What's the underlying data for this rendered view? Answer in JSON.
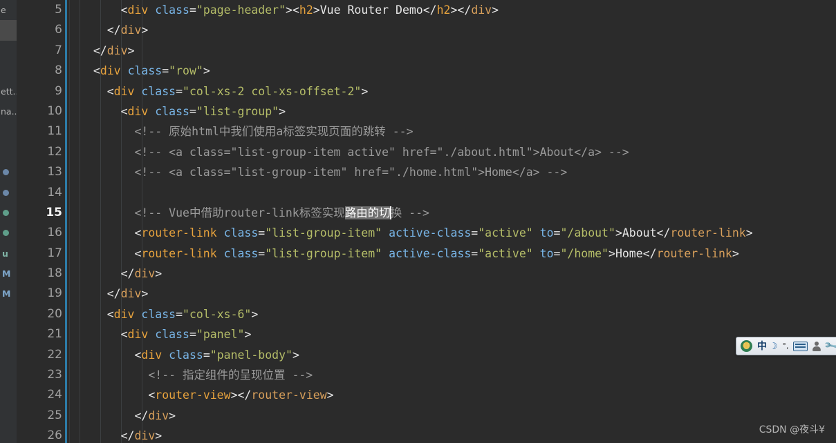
{
  "editor": {
    "first_line_number": 5,
    "active_line_number": 15,
    "lines": [
      {
        "n": 5,
        "segments": [
          {
            "t": "pun",
            "v": "      <"
          },
          {
            "t": "tag",
            "v": "div"
          },
          {
            "t": "pun",
            "v": " "
          },
          {
            "t": "attr",
            "v": "class"
          },
          {
            "t": "pun",
            "v": "="
          },
          {
            "t": "str",
            "v": "\"page-header\""
          },
          {
            "t": "pun",
            "v": "><"
          },
          {
            "t": "tag",
            "v": "h2"
          },
          {
            "t": "pun",
            "v": ">"
          },
          {
            "t": "txtw",
            "v": "Vue Router Demo"
          },
          {
            "t": "pun",
            "v": "</"
          },
          {
            "t": "tag",
            "v": "h2"
          },
          {
            "t": "pun",
            "v": "></"
          },
          {
            "t": "tag2",
            "v": "div"
          },
          {
            "t": "pun",
            "v": ">"
          }
        ]
      },
      {
        "n": 6,
        "segments": [
          {
            "t": "pun",
            "v": "    </"
          },
          {
            "t": "tag2",
            "v": "div"
          },
          {
            "t": "pun",
            "v": ">"
          }
        ]
      },
      {
        "n": 7,
        "segments": [
          {
            "t": "pun",
            "v": "  </"
          },
          {
            "t": "tag2",
            "v": "div"
          },
          {
            "t": "pun",
            "v": ">"
          }
        ]
      },
      {
        "n": 8,
        "segments": [
          {
            "t": "pun",
            "v": "  <"
          },
          {
            "t": "tag",
            "v": "div"
          },
          {
            "t": "pun",
            "v": " "
          },
          {
            "t": "attr",
            "v": "class"
          },
          {
            "t": "pun",
            "v": "="
          },
          {
            "t": "str",
            "v": "\"row\""
          },
          {
            "t": "pun",
            "v": ">"
          }
        ]
      },
      {
        "n": 9,
        "segments": [
          {
            "t": "pun",
            "v": "    <"
          },
          {
            "t": "tag",
            "v": "div"
          },
          {
            "t": "pun",
            "v": " "
          },
          {
            "t": "attr",
            "v": "class"
          },
          {
            "t": "pun",
            "v": "="
          },
          {
            "t": "str",
            "v": "\"col-xs-2 col-xs-offset-2\""
          },
          {
            "t": "pun",
            "v": ">"
          }
        ]
      },
      {
        "n": 10,
        "segments": [
          {
            "t": "pun",
            "v": "      <"
          },
          {
            "t": "tag",
            "v": "div"
          },
          {
            "t": "pun",
            "v": " "
          },
          {
            "t": "attr",
            "v": "class"
          },
          {
            "t": "pun",
            "v": "="
          },
          {
            "t": "str",
            "v": "\"list-group\""
          },
          {
            "t": "pun",
            "v": ">"
          }
        ]
      },
      {
        "n": 11,
        "segments": [
          {
            "t": "cmt",
            "v": "        <!-- 原始html中我们使用a标签实现页面的跳转 -->"
          }
        ]
      },
      {
        "n": 12,
        "segments": [
          {
            "t": "cmt",
            "v": "        <!-- <a class=\"list-group-item active\" href=\"./about.html\">About</a> -->"
          }
        ]
      },
      {
        "n": 13,
        "segments": [
          {
            "t": "cmt",
            "v": "        <!-- <a class=\"list-group-item\" href=\"./home.html\">Home</a> -->"
          }
        ]
      },
      {
        "n": 14,
        "segments": []
      },
      {
        "n": 15,
        "segments": [
          {
            "t": "cmt",
            "v": "        <!-- Vue中借助router-link标签实现"
          },
          {
            "t": "sel",
            "v": "路由的切"
          },
          {
            "t": "caret",
            "v": ""
          },
          {
            "t": "cmt",
            "v": "换 -->"
          }
        ]
      },
      {
        "n": 16,
        "segments": [
          {
            "t": "pun",
            "v": "        <"
          },
          {
            "t": "tag",
            "v": "router-link"
          },
          {
            "t": "pun",
            "v": " "
          },
          {
            "t": "attr",
            "v": "class"
          },
          {
            "t": "pun",
            "v": "="
          },
          {
            "t": "str",
            "v": "\"list-group-item\""
          },
          {
            "t": "pun",
            "v": " "
          },
          {
            "t": "attr",
            "v": "active-class"
          },
          {
            "t": "pun",
            "v": "="
          },
          {
            "t": "str",
            "v": "\"active\""
          },
          {
            "t": "pun",
            "v": " "
          },
          {
            "t": "attr",
            "v": "to"
          },
          {
            "t": "pun",
            "v": "="
          },
          {
            "t": "str",
            "v": "\"/about\""
          },
          {
            "t": "pun",
            "v": ">"
          },
          {
            "t": "txtw",
            "v": "About"
          },
          {
            "t": "pun",
            "v": "</"
          },
          {
            "t": "tag2",
            "v": "router-link"
          },
          {
            "t": "pun",
            "v": ">"
          }
        ]
      },
      {
        "n": 17,
        "segments": [
          {
            "t": "pun",
            "v": "        <"
          },
          {
            "t": "tag",
            "v": "router-link"
          },
          {
            "t": "pun",
            "v": " "
          },
          {
            "t": "attr",
            "v": "class"
          },
          {
            "t": "pun",
            "v": "="
          },
          {
            "t": "str",
            "v": "\"list-group-item\""
          },
          {
            "t": "pun",
            "v": " "
          },
          {
            "t": "attr",
            "v": "active-class"
          },
          {
            "t": "pun",
            "v": "="
          },
          {
            "t": "str",
            "v": "\"active\""
          },
          {
            "t": "pun",
            "v": " "
          },
          {
            "t": "attr",
            "v": "to"
          },
          {
            "t": "pun",
            "v": "="
          },
          {
            "t": "str",
            "v": "\"/home\""
          },
          {
            "t": "pun",
            "v": ">"
          },
          {
            "t": "txtw",
            "v": "Home"
          },
          {
            "t": "pun",
            "v": "</"
          },
          {
            "t": "tag2",
            "v": "router-link"
          },
          {
            "t": "pun",
            "v": ">"
          }
        ]
      },
      {
        "n": 18,
        "segments": [
          {
            "t": "pun",
            "v": "      </"
          },
          {
            "t": "tag2",
            "v": "div"
          },
          {
            "t": "pun",
            "v": ">"
          }
        ]
      },
      {
        "n": 19,
        "segments": [
          {
            "t": "pun",
            "v": "    </"
          },
          {
            "t": "tag2",
            "v": "div"
          },
          {
            "t": "pun",
            "v": ">"
          }
        ]
      },
      {
        "n": 20,
        "segments": [
          {
            "t": "pun",
            "v": "    <"
          },
          {
            "t": "tag",
            "v": "div"
          },
          {
            "t": "pun",
            "v": " "
          },
          {
            "t": "attr",
            "v": "class"
          },
          {
            "t": "pun",
            "v": "="
          },
          {
            "t": "str",
            "v": "\"col-xs-6\""
          },
          {
            "t": "pun",
            "v": ">"
          }
        ]
      },
      {
        "n": 21,
        "segments": [
          {
            "t": "pun",
            "v": "      <"
          },
          {
            "t": "tag",
            "v": "div"
          },
          {
            "t": "pun",
            "v": " "
          },
          {
            "t": "attr",
            "v": "class"
          },
          {
            "t": "pun",
            "v": "="
          },
          {
            "t": "str",
            "v": "\"panel\""
          },
          {
            "t": "pun",
            "v": ">"
          }
        ]
      },
      {
        "n": 22,
        "segments": [
          {
            "t": "pun",
            "v": "        <"
          },
          {
            "t": "tag",
            "v": "div"
          },
          {
            "t": "pun",
            "v": " "
          },
          {
            "t": "attr",
            "v": "class"
          },
          {
            "t": "pun",
            "v": "="
          },
          {
            "t": "str",
            "v": "\"panel-body\""
          },
          {
            "t": "pun",
            "v": ">"
          }
        ]
      },
      {
        "n": 23,
        "segments": [
          {
            "t": "cmt",
            "v": "          <!-- 指定组件的呈现位置 -->"
          }
        ]
      },
      {
        "n": 24,
        "segments": [
          {
            "t": "pun",
            "v": "          <"
          },
          {
            "t": "tag",
            "v": "router-view"
          },
          {
            "t": "pun",
            "v": "></"
          },
          {
            "t": "tag2",
            "v": "router-view"
          },
          {
            "t": "pun",
            "v": ">"
          }
        ]
      },
      {
        "n": 25,
        "segments": [
          {
            "t": "pun",
            "v": "        </"
          },
          {
            "t": "tag2",
            "v": "div"
          },
          {
            "t": "pun",
            "v": ">"
          }
        ]
      },
      {
        "n": 26,
        "segments": [
          {
            "t": "pun",
            "v": "      </"
          },
          {
            "t": "tag2",
            "v": "div"
          },
          {
            "t": "pun",
            "v": ">"
          }
        ]
      }
    ]
  },
  "sidebar": {
    "items": [
      {
        "kind": "text",
        "label": "e",
        "selected": false
      },
      {
        "kind": "text",
        "label": "",
        "selected": true
      },
      {
        "kind": "text",
        "label": "",
        "selected": false
      },
      {
        "kind": "text",
        "label": "",
        "selected": false
      },
      {
        "kind": "text",
        "label": "ett...",
        "selected": false
      },
      {
        "kind": "text",
        "label": "na...",
        "selected": false
      },
      {
        "kind": "text",
        "label": "",
        "selected": false
      },
      {
        "kind": "text",
        "label": "",
        "selected": false
      },
      {
        "kind": "dot",
        "color": "#6b87a8"
      },
      {
        "kind": "dot",
        "color": "#6b87a8"
      },
      {
        "kind": "dot",
        "color": "#5f9e8a"
      },
      {
        "kind": "dot",
        "color": "#5f9e8a"
      },
      {
        "kind": "letter",
        "label": "u",
        "color": "#7fb3a5"
      },
      {
        "kind": "letter",
        "label": "M",
        "color": "#7fa8cc"
      },
      {
        "kind": "letter",
        "label": "M",
        "color": "#7fa8cc"
      }
    ]
  },
  "ime_toolbar": {
    "logo_label": "U",
    "mode_label": "中",
    "shape_label": "☽",
    "punct_label": "°,",
    "keyboard_label": "keyboard",
    "user_label": "user",
    "tools_label": "🔧"
  },
  "watermark": {
    "text": "CSDN @夜斗¥"
  },
  "colors": {
    "background": "#2b2b2b",
    "gutter": "#2b2b2b",
    "sidebar": "#313335",
    "accent_bar": "#2d7ca8",
    "tag": "#e8a33d",
    "attribute": "#79b6e8",
    "string": "#b5bd68",
    "comment": "#9a9a9a",
    "text": "#e6e6e6",
    "selection": "#6f6f6f"
  }
}
